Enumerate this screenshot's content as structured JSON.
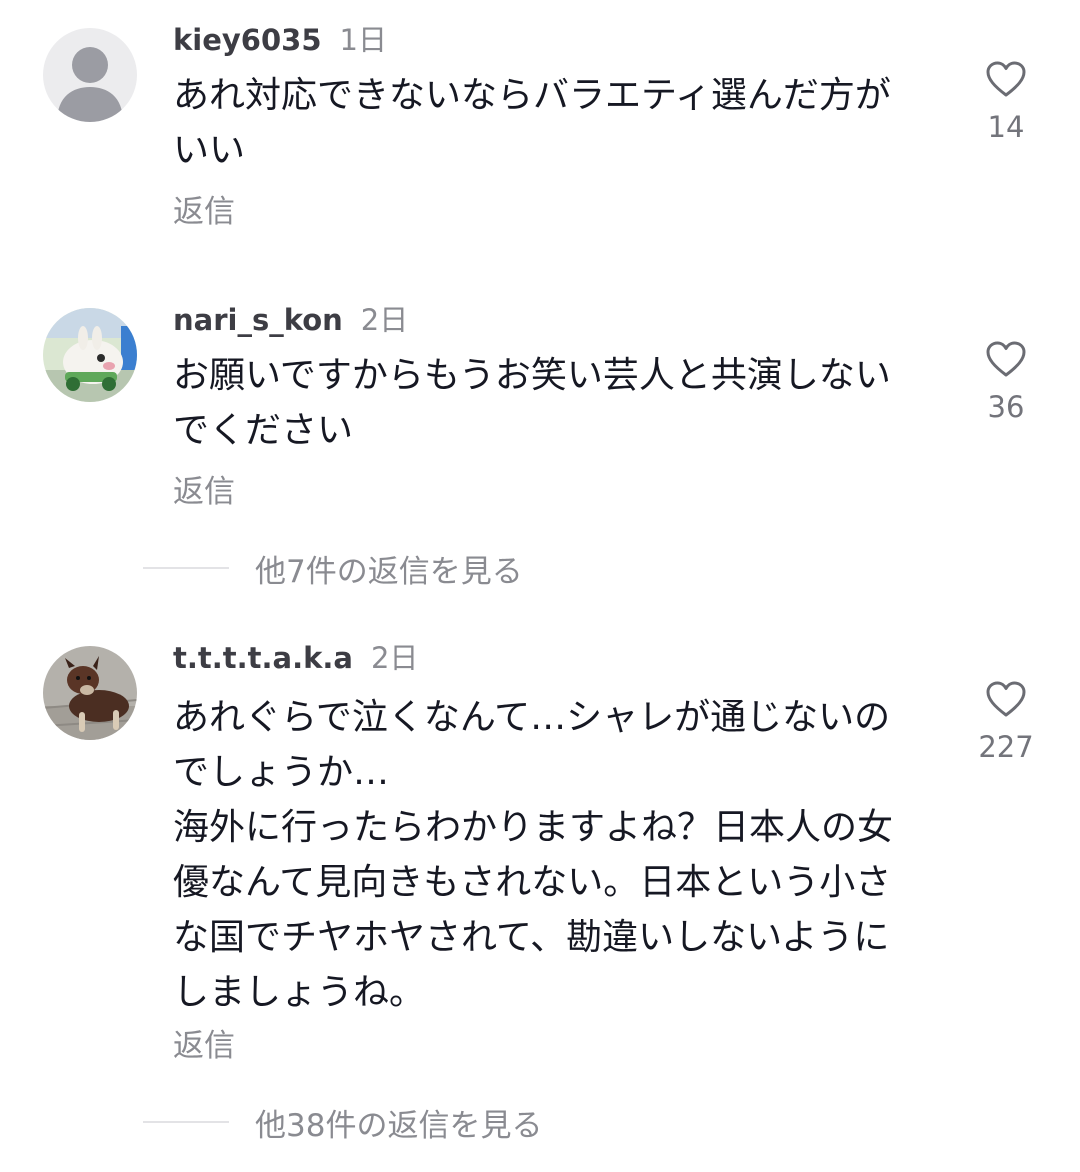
{
  "comments": [
    {
      "username": "kiey6035",
      "time": "1日",
      "text": "あれ対応できないならバラエティ選んだ方がいい",
      "reply_label": "返信",
      "likes": "14",
      "avatar": "default-avatar-icon"
    },
    {
      "username": "nari_s_kon",
      "time": "2日",
      "text": "お願いですからもうお笑い芸人と共演しないでください",
      "reply_label": "返信",
      "likes": "36",
      "avatar": "toy-rabbit-car-photo"
    },
    {
      "username": "t.t.t.t.a.k.a",
      "time": "2日",
      "text": "あれぐらで泣くなんて…シャレが通じないのでしょうか…\n海外に行ったらわかりますよね？日本人の女優なんて見向きもされない。日本という小さな国でチヤホヤされて、勘違いしないようにしましょうね。",
      "reply_label": "返信",
      "likes": "227",
      "avatar": "dog-photo"
    }
  ],
  "view_more": [
    "他7件の返信を見る",
    "他38件の返信を見る"
  ],
  "colors": {
    "text": "#161823",
    "secondary": "#8a8b91",
    "username": "#3d3d44",
    "divider": "#e3e3e6"
  }
}
